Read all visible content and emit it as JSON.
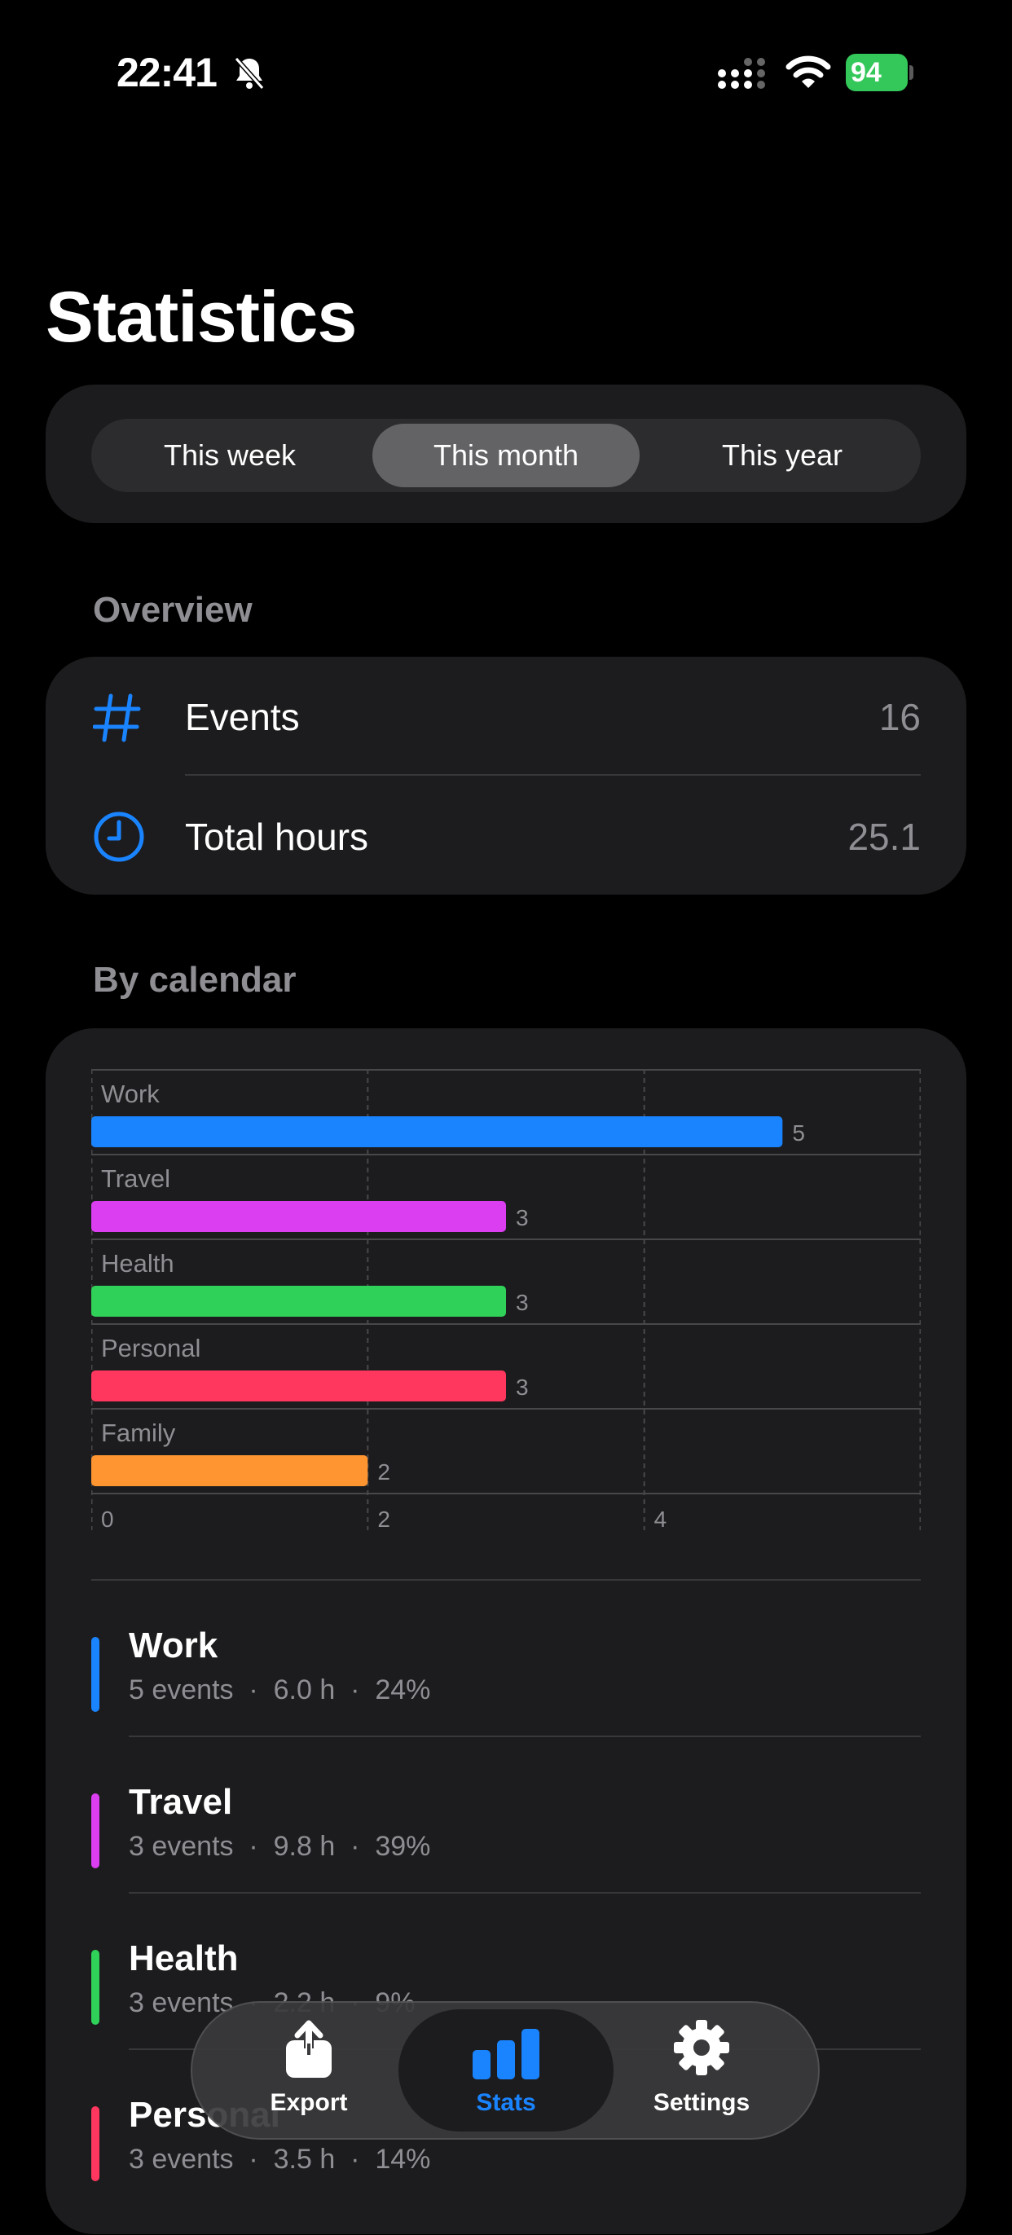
{
  "status_bar": {
    "time": "22:41",
    "battery": "94"
  },
  "page_title": "Statistics",
  "segments": [
    "This week",
    "This month",
    "This year"
  ],
  "selected_segment": "This month",
  "overview": {
    "label": "Overview",
    "events_label": "Events",
    "events_value": "16",
    "hours_label": "Total hours",
    "hours_value": "25.1"
  },
  "by_calendar_label": "By calendar",
  "chart_data": {
    "type": "bar",
    "orientation": "horizontal",
    "categories": [
      "Work",
      "Travel",
      "Health",
      "Personal",
      "Family"
    ],
    "values": [
      5,
      3,
      3,
      3,
      2
    ],
    "colors": [
      "#1a84ff",
      "#da3ef0",
      "#30d158",
      "#ff375f",
      "#ff9530"
    ],
    "x_ticks": [
      0,
      2,
      4
    ],
    "xlim": [
      0,
      6
    ],
    "grid": true
  },
  "calendars": [
    {
      "name": "Work",
      "detail": "5 events  ·  6.0 h  ·  24%",
      "color": "#1a84ff"
    },
    {
      "name": "Travel",
      "detail": "3 events  ·  9.8 h  ·  39%",
      "color": "#da3ef0"
    },
    {
      "name": "Health",
      "detail": "3 events  ·  2.2 h  ·  9%",
      "color": "#30d158"
    },
    {
      "name": "Personal",
      "detail": "3 events  ·  3.5 h  ·  14%",
      "color": "#ff375f"
    }
  ],
  "tabs": [
    {
      "label": "Export",
      "icon": "share-icon"
    },
    {
      "label": "Stats",
      "icon": "chart-bars-icon"
    },
    {
      "label": "Settings",
      "icon": "gear-icon"
    }
  ],
  "colors": {
    "accent": "#1a84ff"
  }
}
